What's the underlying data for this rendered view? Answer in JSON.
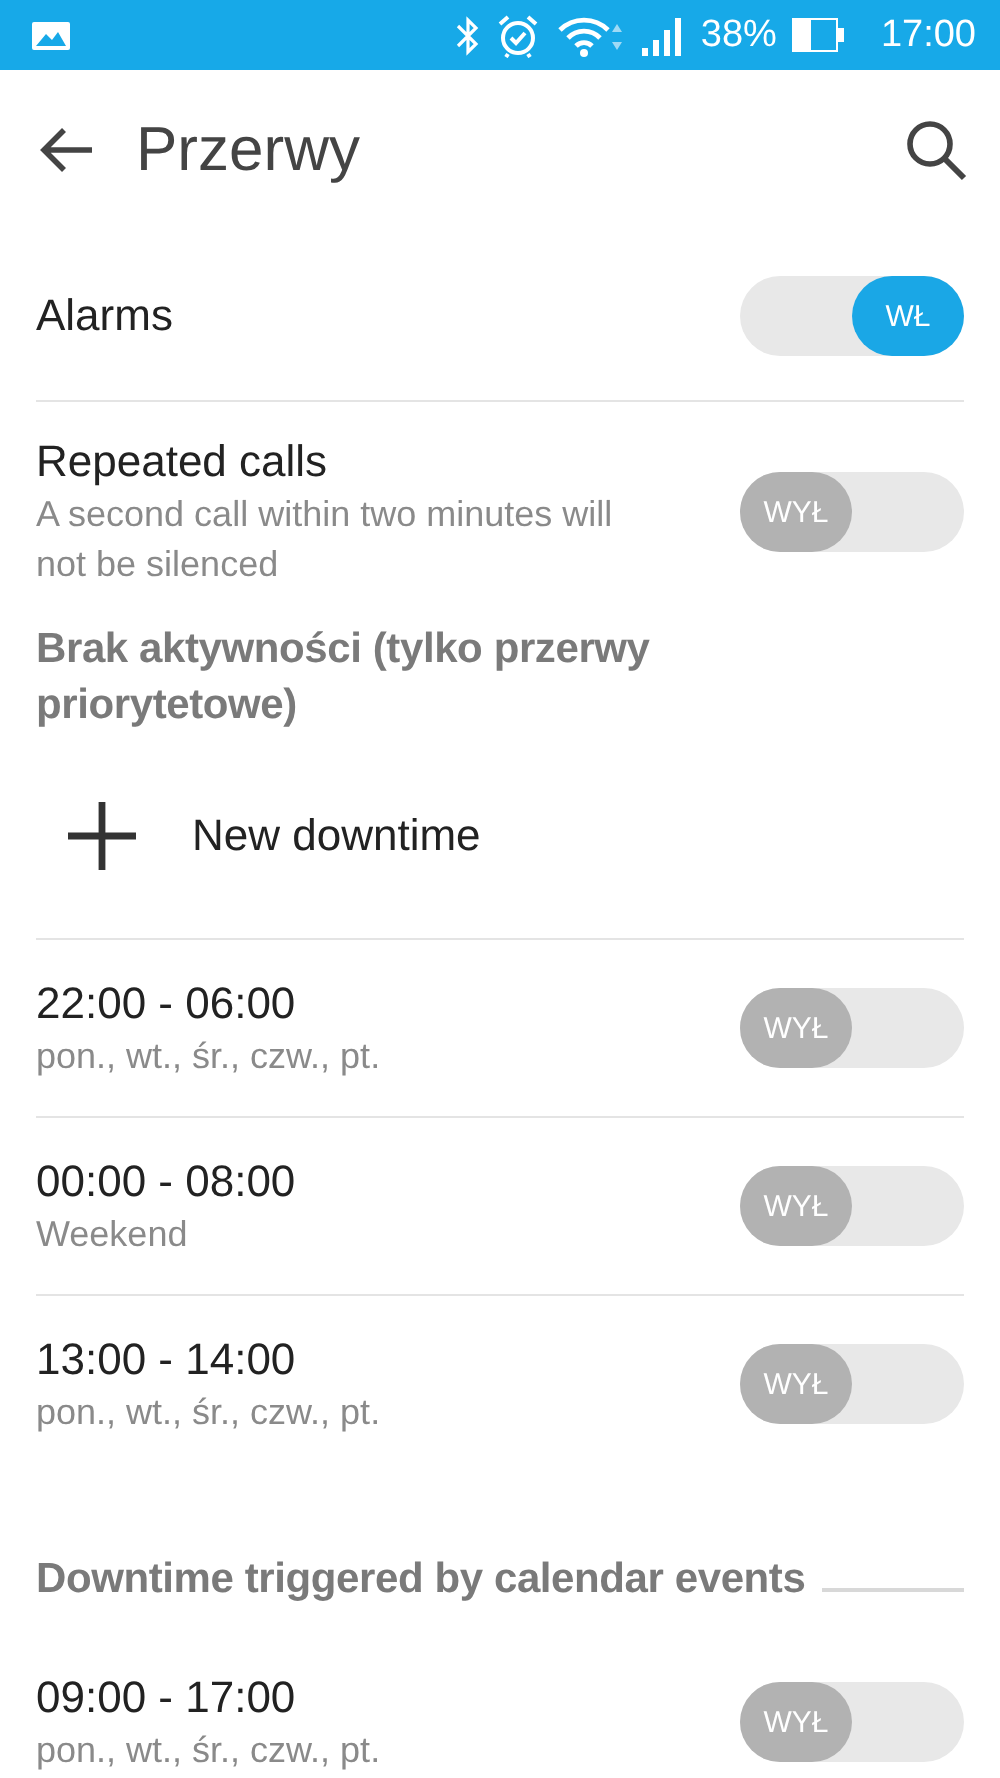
{
  "status_bar": {
    "battery": "38%",
    "time": "17:00"
  },
  "app_bar": {
    "title": "Przerwy"
  },
  "settings": [
    {
      "title": "Alarms",
      "toggle": {
        "on": true,
        "label": "WŁ"
      }
    },
    {
      "title": "Repeated calls",
      "subtitle": "A second call within two minutes will not be silenced",
      "toggle": {
        "on": false,
        "label": "WYŁ"
      }
    }
  ],
  "downtime_section": {
    "header": "Brak aktywności (tylko przerwy priorytetowe)",
    "add_label": "New downtime",
    "rules": [
      {
        "time": "22:00 - 06:00",
        "days": "pon., wt., śr., czw., pt.",
        "toggle": {
          "on": false,
          "label": "WYŁ"
        }
      },
      {
        "time": "00:00 - 08:00",
        "days": "Weekend",
        "toggle": {
          "on": false,
          "label": "WYŁ"
        }
      },
      {
        "time": "13:00 - 14:00",
        "days": "pon., wt., śr., czw., pt.",
        "toggle": {
          "on": false,
          "label": "WYŁ"
        }
      }
    ]
  },
  "calendar_section": {
    "header": "Downtime triggered by calendar events",
    "rules": [
      {
        "time": "09:00 - 17:00",
        "days": "pon., wt., śr., czw., pt.",
        "toggle": {
          "on": false,
          "label": "WYŁ"
        }
      }
    ]
  }
}
